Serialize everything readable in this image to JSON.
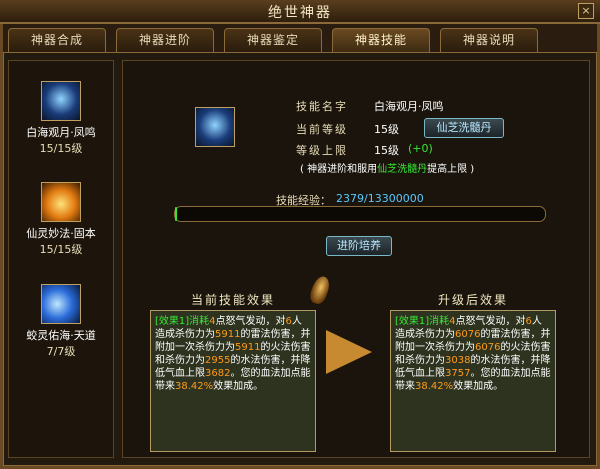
{
  "window": {
    "title": "绝世神器",
    "close": "×"
  },
  "tabs": [
    "神器合成",
    "神器进阶",
    "神器鉴定",
    "神器技能",
    "神器说明"
  ],
  "active_tab": 3,
  "skills": [
    {
      "name": "白海观月·凤鸣",
      "level": "15/15级",
      "icon": "moon-icon"
    },
    {
      "name": "仙灵妙法·固本",
      "level": "15/15级",
      "icon": "flame-icon"
    },
    {
      "name": "蛟灵佑海·天道",
      "level": "7/7级",
      "icon": "wave-icon"
    }
  ],
  "detail": {
    "name_label": "技能名字",
    "name_value": "白海观月·凤鸣",
    "cur_label": "当前等级",
    "cur_value": "15级",
    "max_label": "等级上限",
    "max_value": "15级",
    "max_bonus": "(+0)",
    "wash_button": "仙芝洗髓丹",
    "note_pre": "( 神器进阶和服用",
    "note_hl": "仙芝洗髓丹",
    "note_post": "提高上限 )",
    "exp_label": "技能经验：",
    "exp_value": "2379/13300000",
    "exp_ratio": 0.000179,
    "train_button": "进阶培养"
  },
  "current_effect": {
    "title": "当前技能效果",
    "lines": [
      "[效果1]消耗",
      "4",
      "点怒气发动，对",
      "6",
      "人造成杀伤力为",
      "5911",
      "的雷法伤害，并附加一次杀伤力为",
      "5911",
      "的火法伤害和杀伤力为",
      "2955",
      "的水法伤害，并降低气血上限",
      "3682",
      "。您的血法加点能带来",
      "38.42%",
      "效果加成。"
    ]
  },
  "next_effect": {
    "title": "升级后效果",
    "lines": [
      "[效果1]消耗",
      "4",
      "点怒气发动，对",
      "6",
      "人造成杀伤力为",
      "6076",
      "的雷法伤害，并附加一次杀伤力为",
      "6076",
      "的火法伤害和杀伤力为",
      "3038",
      "的水法伤害，并降低气血上限",
      "3757",
      "。您的血法加点能带来",
      "38.42%",
      "效果加成。"
    ]
  }
}
